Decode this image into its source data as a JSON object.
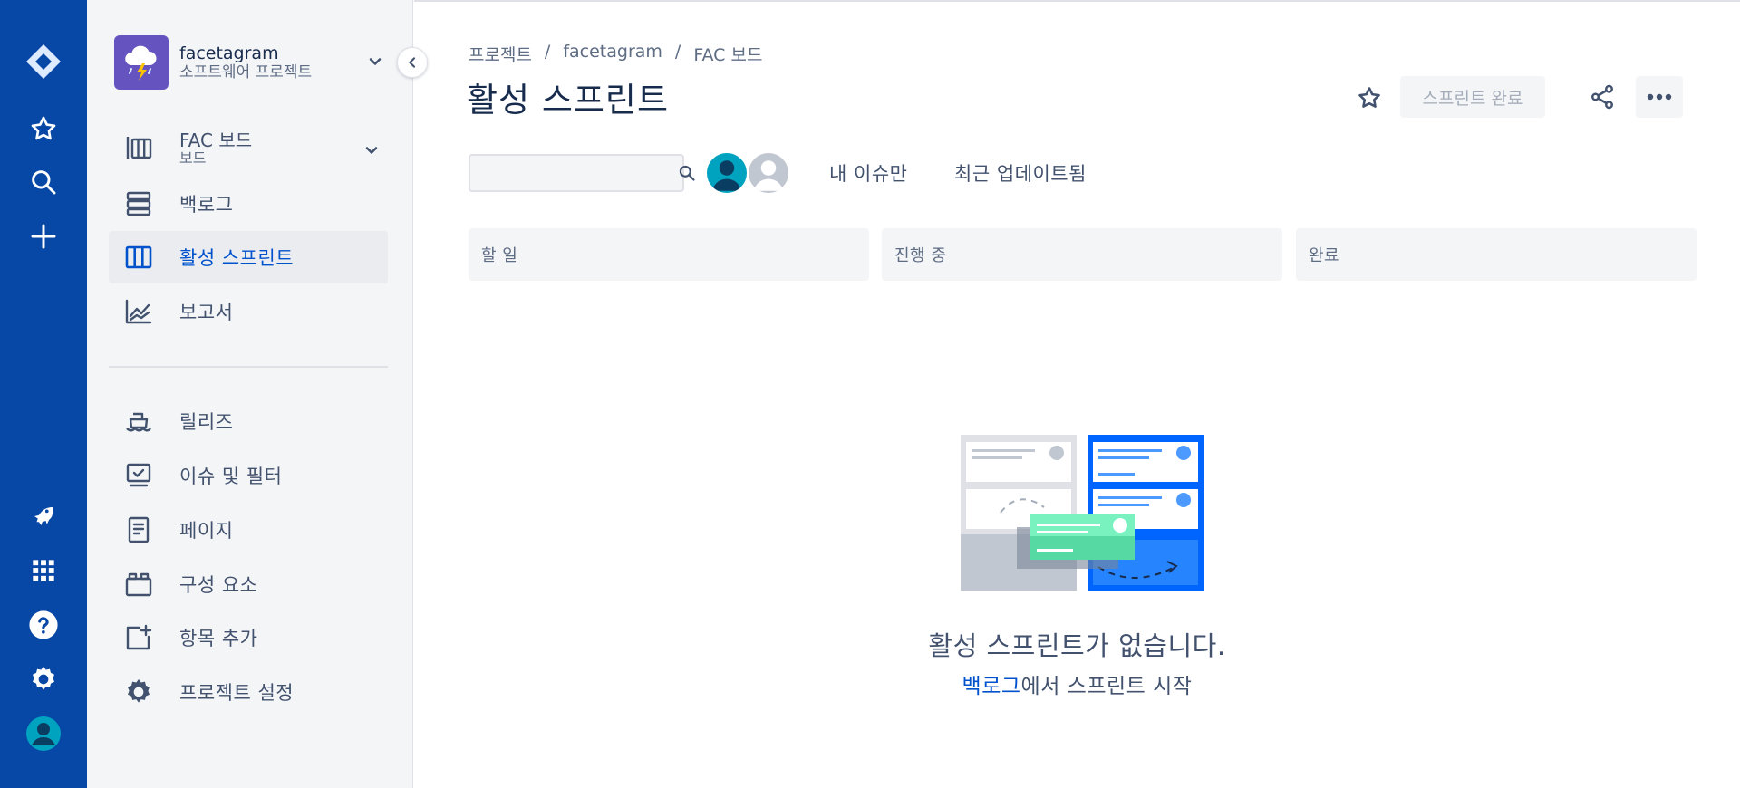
{
  "project": {
    "name": "facetagram",
    "type": "소프트웨어 프로젝트"
  },
  "board_selector": {
    "name": "FAC 보드",
    "subtitle": "보드"
  },
  "sidebar": {
    "items": [
      {
        "label": "백로그",
        "icon": "backlog-icon"
      },
      {
        "label": "활성 스프린트",
        "icon": "board-icon",
        "active": true
      },
      {
        "label": "보고서",
        "icon": "chart-icon"
      },
      {
        "label": "릴리즈",
        "icon": "ship-icon"
      },
      {
        "label": "이슈 및 필터",
        "icon": "issues-icon"
      },
      {
        "label": "페이지",
        "icon": "page-icon"
      },
      {
        "label": "구성 요소",
        "icon": "component-icon"
      },
      {
        "label": "항목 추가",
        "icon": "add-item-icon"
      },
      {
        "label": "프로젝트 설정",
        "icon": "gear-icon"
      }
    ]
  },
  "breadcrumb": [
    "프로젝트",
    "facetagram",
    "FAC 보드"
  ],
  "page": {
    "title": "활성 스프린트",
    "complete_label": "스프린트 완료"
  },
  "search": {
    "value": "",
    "placeholder": ""
  },
  "filters": {
    "my_issues": "내 이슈만",
    "recently_updated": "최근 업데이트됨"
  },
  "columns": [
    "할 일",
    "진행 중",
    "완료"
  ],
  "empty": {
    "title": "활성 스프린트가 없습니다.",
    "link": "백로그",
    "suffix": "에서 스프린트 시작"
  },
  "colors": {
    "global_nav": "#0747a6",
    "accent": "#0052cc",
    "sidebar_bg": "#f4f5f7",
    "project_avatar": "#6554c0",
    "user_avatar": "#00a3bf"
  }
}
